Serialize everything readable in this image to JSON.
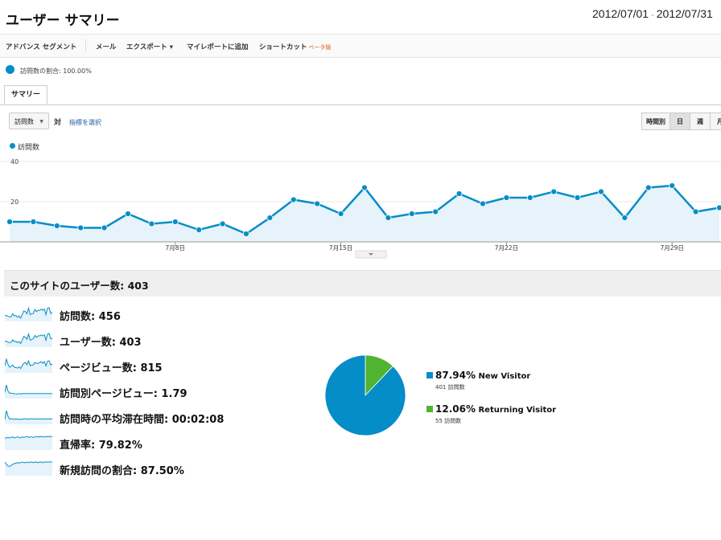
{
  "header": {
    "title": "ユーザー サマリー",
    "date_start": "2012/07/01",
    "date_sep": "-",
    "date_end": "2012/07/31"
  },
  "toolbar": {
    "advanced_segment": "アドバンス セグメント",
    "email": "メール",
    "export": "エクスポート ▾",
    "add_to_dashboard": "マイレポートに追加",
    "shortcut": "ショートカット",
    "beta": "ベータ版"
  },
  "segment": {
    "label": "訪問数の割合: 100.00%"
  },
  "tabs": [
    {
      "label": "サマリー"
    }
  ],
  "controls": {
    "metric": "訪問数",
    "vs": "対",
    "pick_metric": "指標を選択",
    "granularity": [
      "時間別",
      "日",
      "週",
      "月"
    ]
  },
  "legend": {
    "label": "訪問数"
  },
  "colors": {
    "series": "#058dc7",
    "area": "#e6f3fa",
    "new": "#058dc7",
    "returning": "#50b432"
  },
  "chart_data": {
    "type": "area",
    "series": [
      {
        "name": "訪問数",
        "values": [
          10,
          10,
          8,
          7,
          7,
          14,
          9,
          10,
          6,
          9,
          4,
          12,
          21,
          19,
          14,
          27,
          12,
          14,
          15,
          24,
          19,
          22,
          22,
          25,
          22,
          25,
          12,
          27,
          28,
          15,
          17
        ]
      }
    ],
    "x": [
      1,
      2,
      3,
      4,
      5,
      6,
      7,
      8,
      9,
      10,
      11,
      12,
      13,
      14,
      15,
      16,
      17,
      18,
      19,
      20,
      21,
      22,
      23,
      24,
      25,
      26,
      27,
      28,
      29,
      30,
      31
    ],
    "x_tick_labels": [
      "7月8日",
      "7月15日",
      "7月22日",
      "7月29日"
    ],
    "x_tick_days": [
      8,
      15,
      22,
      29
    ],
    "y_tick_labels": [
      "40",
      "20"
    ],
    "ylim": [
      0,
      40
    ],
    "grid": true
  },
  "summary": {
    "title": "このサイトのユーザー数: 403",
    "stats": [
      {
        "label": "訪問数: 456",
        "spark": [
          10,
          10,
          8,
          7,
          7,
          14,
          9,
          10,
          6,
          9,
          4,
          12,
          21,
          19,
          14,
          27,
          12,
          14,
          15,
          24,
          19,
          22,
          22,
          25,
          22,
          25,
          12,
          27,
          28,
          15,
          17
        ]
      },
      {
        "label": "ユーザー数: 403",
        "spark": [
          9,
          9,
          7,
          6,
          7,
          12,
          8,
          9,
          6,
          8,
          4,
          11,
          19,
          17,
          13,
          24,
          11,
          13,
          14,
          21,
          17,
          20,
          20,
          22,
          20,
          22,
          11,
          24,
          25,
          14,
          15
        ]
      },
      {
        "label": "ページビュー数: 815",
        "spark": [
          14,
          30,
          18,
          10,
          12,
          16,
          10,
          9,
          8,
          11,
          7,
          14,
          20,
          22,
          16,
          26,
          14,
          15,
          16,
          22,
          19,
          20,
          21,
          24,
          20,
          24,
          13,
          25,
          26,
          16,
          18
        ]
      },
      {
        "label": "訪問別ページビュー: 1.79",
        "spark": [
          10,
          28,
          14,
          9,
          9,
          8,
          8,
          7,
          7,
          8,
          7,
          8,
          8,
          8,
          8,
          8,
          8,
          8,
          8,
          8,
          8,
          8,
          8,
          8,
          8,
          8,
          8,
          8,
          8,
          8,
          8
        ]
      },
      {
        "label": "訪問時の平均滞在時間: 00:02:08",
        "spark": [
          8,
          30,
          16,
          9,
          10,
          9,
          8,
          10,
          8,
          9,
          8,
          9,
          9,
          10,
          9,
          9,
          9,
          10,
          9,
          9,
          10,
          9,
          9,
          10,
          9,
          9,
          10,
          9,
          9,
          10,
          9
        ]
      },
      {
        "label": "直帰率: 79.82%",
        "spark": [
          20,
          20,
          21,
          20,
          21,
          22,
          20,
          21,
          22,
          21,
          20,
          22,
          21,
          22,
          23,
          21,
          22,
          22,
          21,
          22,
          23,
          22,
          22,
          23,
          22,
          22,
          23,
          22,
          23,
          23,
          22
        ]
      },
      {
        "label": "新規訪問の割合: 87.50%",
        "spark": [
          22,
          18,
          15,
          14,
          16,
          18,
          19,
          20,
          21,
          20,
          21,
          22,
          21,
          21,
          22,
          21,
          22,
          22,
          21,
          22,
          22,
          21,
          22,
          22,
          21,
          22,
          22,
          22,
          22,
          22,
          22
        ]
      }
    ]
  },
  "pie": {
    "slices": [
      {
        "name": "New Visitor",
        "percent": "87.94%",
        "value": 87.94,
        "count": "401 訪問数"
      },
      {
        "name": "Returning Visitor",
        "percent": "12.06%",
        "value": 12.06,
        "count": "55 訪問数"
      }
    ]
  }
}
